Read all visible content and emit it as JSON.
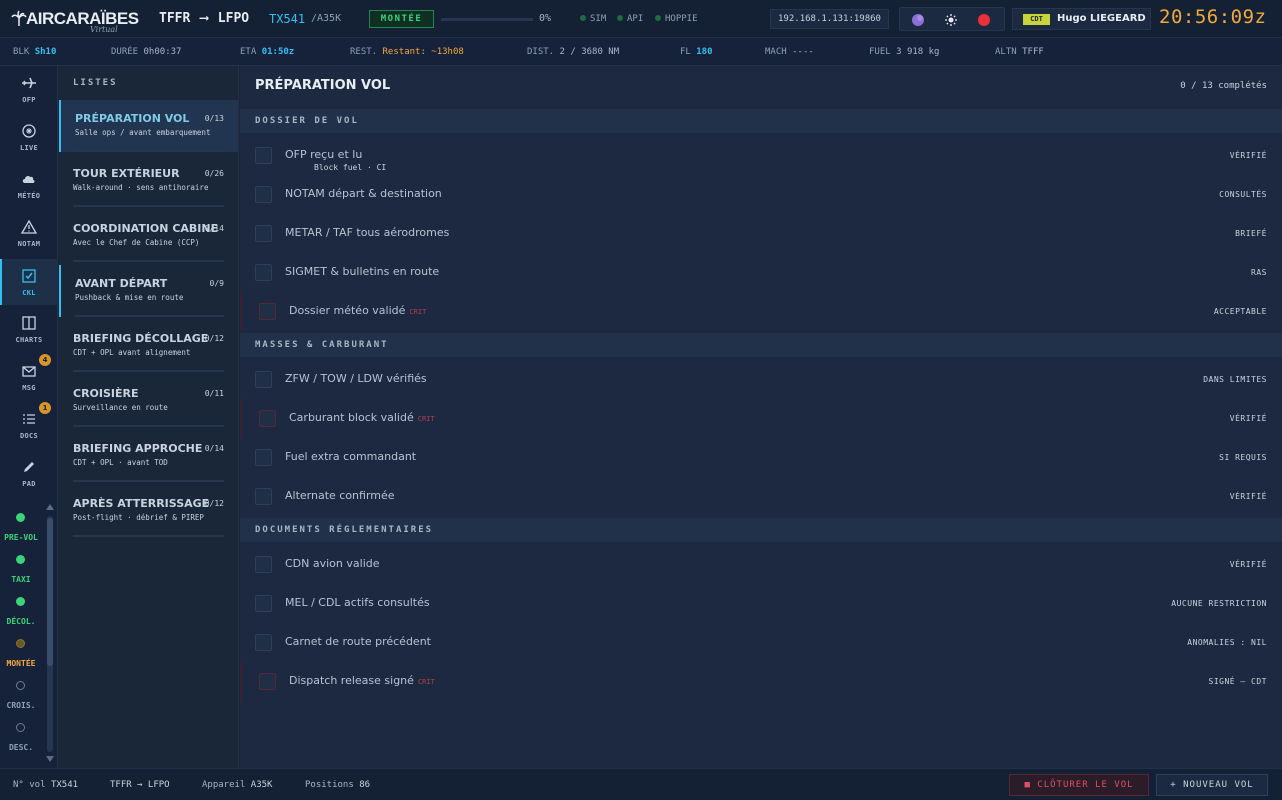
{
  "header": {
    "logo_text": "AIRCARAÏBES",
    "logo_sub": "Virtual",
    "origin": "TFFR",
    "destination": "LFPO",
    "flight_number": "TX541",
    "aircraft": "/A35K",
    "phase_badge": "MONTÉE",
    "progress_pct": 0,
    "progress_text": "0%",
    "connections": [
      "SIM",
      "API",
      "HOPPIE"
    ],
    "ip": "192.168.1.131:19860",
    "rank": "CDT",
    "user_name": "Hugo LIEGEARD",
    "clock": "20:56:09z"
  },
  "infobar": {
    "blk_label": "BLK",
    "blk_value": "Sh10",
    "duree_label": "DURÉE",
    "duree_value": "0h00:37",
    "eta_label": "ETA",
    "eta_value": "01:50z",
    "rest_label": "REST.",
    "rest_value": "Restant: ~13h08",
    "dist_label": "DIST.",
    "dist_value": "2 / 3680 NM",
    "fl_label": "FL",
    "fl_value": "180",
    "mach_label": "MACH",
    "mach_value": "----",
    "fuel_label": "FUEL",
    "fuel_value": "3 918 kg",
    "altn_label": "ALTN",
    "altn_value": "TFFF"
  },
  "nav": [
    {
      "label": "OFP",
      "icon": "plane-icon"
    },
    {
      "label": "LIVE",
      "icon": "radar-icon"
    },
    {
      "label": "MÉTÉO",
      "icon": "cloud-icon"
    },
    {
      "label": "NOTAM",
      "icon": "warning-icon"
    },
    {
      "label": "CKL",
      "icon": "checkbox-icon"
    },
    {
      "label": "CHARTS",
      "icon": "map-icon"
    },
    {
      "label": "MSG",
      "icon": "mail-icon",
      "badge": "4"
    },
    {
      "label": "DOCS",
      "icon": "list-icon",
      "badge": "1"
    },
    {
      "label": "PAD",
      "icon": "pencil-icon"
    }
  ],
  "phases": [
    {
      "label": "PRE-VOL",
      "state": "done",
      "color": "#39d37a"
    },
    {
      "label": "TAXI",
      "state": "done",
      "color": "#39d37a"
    },
    {
      "label": "DÉCOL.",
      "state": "done",
      "color": "#39d37a"
    },
    {
      "label": "MONTÉE",
      "state": "current",
      "color": "#f2a93a"
    },
    {
      "label": "CROIS.",
      "state": "pending",
      "color": "#6b7c94"
    },
    {
      "label": "DESC.",
      "state": "pending",
      "color": "#6b7c94"
    }
  ],
  "lists": {
    "header": "LISTES",
    "items": [
      {
        "title": "PRÉPARATION VOL",
        "count": "0/13",
        "sub": "Salle ops / avant embarquement"
      },
      {
        "title": "TOUR EXTÉRIEUR",
        "count": "0/26",
        "sub": "Walk-around · sens antihoraire"
      },
      {
        "title": "COORDINATION CABINE",
        "count": "0/14",
        "sub": "Avec le Chef de Cabine (CCP)"
      },
      {
        "title": "AVANT DÉPART",
        "count": "0/9",
        "sub": "Pushback & mise en route"
      },
      {
        "title": "BRIEFING DÉCOLLAGE",
        "count": "0/12",
        "sub": "CDT + OPL avant alignement"
      },
      {
        "title": "CROISIÈRE",
        "count": "0/11",
        "sub": "Surveillance en route"
      },
      {
        "title": "BRIEFING APPROCHE",
        "count": "0/14",
        "sub": "CDT + OPL · avant TOD"
      },
      {
        "title": "APRÈS ATTERRISSAGE",
        "count": "0/12",
        "sub": "Post-flight · débrief & PIREP"
      }
    ]
  },
  "main": {
    "title": "PRÉPARATION VOL",
    "count": "0 / 13 complétés",
    "crit_label": "CRIT",
    "sections": [
      {
        "title": "DOSSIER DE VOL",
        "rows": [
          {
            "label": "OFP reçu et lu",
            "sub": "Block fuel · CI",
            "status": "VÉRIFIÉ",
            "critical": false
          },
          {
            "label": "NOTAM départ & destination",
            "status": "CONSULTÉS",
            "critical": false
          },
          {
            "label": "METAR / TAF tous aérodromes",
            "status": "BRIEFÉ",
            "critical": false
          },
          {
            "label": "SIGMET & bulletins en route",
            "status": "RAS",
            "critical": false
          },
          {
            "label": "Dossier météo validé",
            "status": "ACCEPTABLE",
            "critical": true
          }
        ]
      },
      {
        "title": "MASSES & CARBURANT",
        "rows": [
          {
            "label": "ZFW / TOW / LDW vérifiés",
            "status": "DANS LIMITES",
            "critical": false
          },
          {
            "label": "Carburant block validé",
            "status": "VÉRIFIÉ",
            "critical": true
          },
          {
            "label": "Fuel extra commandant",
            "status": "SI REQUIS",
            "critical": false
          },
          {
            "label": "Alternate confirmée",
            "status": "VÉRIFIÉ",
            "critical": false
          }
        ]
      },
      {
        "title": "DOCUMENTS RÉGLEMENTAIRES",
        "rows": [
          {
            "label": "CDN avion valide",
            "status": "VÉRIFIÉ",
            "critical": false
          },
          {
            "label": "MEL / CDL actifs consultés",
            "status": "AUCUNE RESTRICTION",
            "critical": false
          },
          {
            "label": "Carnet de route précédent",
            "status": "ANOMALIES : NIL",
            "critical": false
          },
          {
            "label": "Dispatch release signé",
            "status": "SIGNÉ — CDT",
            "critical": true
          }
        ]
      }
    ]
  },
  "footer": {
    "flight_label": "N° vol",
    "flight_value": "TX541",
    "route_value": "TFFR → LFPO",
    "aircraft_label": "Appareil",
    "aircraft_value": "A35K",
    "positions_label": "Positions",
    "positions_value": "86",
    "close_button": "■ CLÔTURER LE VOL",
    "new_button": "+ NOUVEAU VOL"
  },
  "colors": {
    "accent": "#33c0f0",
    "warning": "#f2a93a",
    "ok": "#39d37a",
    "critical": "#e05060"
  }
}
